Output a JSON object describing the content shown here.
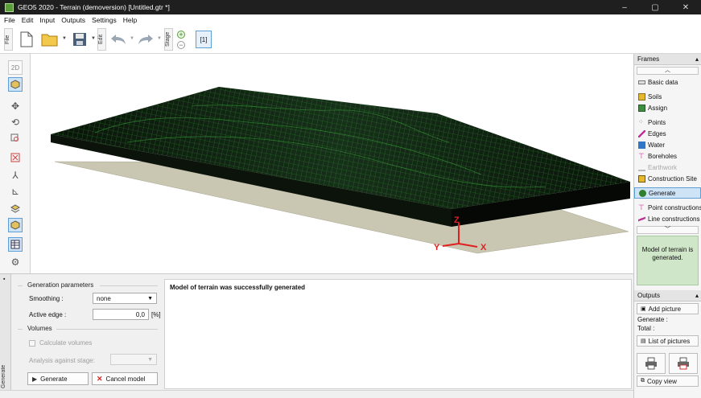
{
  "window": {
    "title": "GEO5 2020 - Terrain (demoversion) [Untitled.gtr *]",
    "minimize": "–",
    "maximize": "▢",
    "close": "✕"
  },
  "menu": [
    "File",
    "Edit",
    "Input",
    "Outputs",
    "Settings",
    "Help"
  ],
  "toolbar": {
    "file_label": "File",
    "edit_label": "Edit",
    "stage_label": "Stage",
    "stage_value": "[1]"
  },
  "left_tools": {
    "view_2d": "2D"
  },
  "viewport": {
    "axis_z": "Z",
    "axis_y": "Y",
    "axis_x": "X"
  },
  "right_panel": {
    "frames_label": "Frames",
    "items": [
      {
        "label": "Basic data",
        "state": "normal"
      },
      {
        "label": "Soils",
        "state": "normal"
      },
      {
        "label": "Assign",
        "state": "normal"
      },
      {
        "label": "Points",
        "state": "normal"
      },
      {
        "label": "Edges",
        "state": "normal"
      },
      {
        "label": "Water",
        "state": "normal"
      },
      {
        "label": "Boreholes",
        "state": "normal"
      },
      {
        "label": "Earthwork",
        "state": "disabled"
      },
      {
        "label": "Construction Site",
        "state": "normal"
      },
      {
        "label": "Generate",
        "state": "active"
      },
      {
        "label": "Point constructions",
        "state": "normal"
      },
      {
        "label": "Line constructions",
        "state": "normal"
      }
    ],
    "note": "Model of terrain is generated.",
    "outputs_label": "Outputs",
    "add_picture": "Add picture",
    "generate_label": "Generate :",
    "total_label": "Total :",
    "list_pictures": "List of pictures",
    "copy_view": "Copy view"
  },
  "bottom": {
    "tab_label": "Generate",
    "generation_params": "Generation parameters",
    "smoothing_label": "Smoothing :",
    "smoothing_value": "none",
    "active_edge_label": "Active edge :",
    "active_edge_value": "0,0",
    "active_edge_unit": "[%]",
    "volumes": "Volumes",
    "calc_volumes": "Calculate volumes",
    "analysis_stage": "Analysis against stage:",
    "generate_btn": "Generate",
    "cancel_btn": "Cancel model",
    "output_text": "Model of terrain was successfully generated"
  },
  "colors": {
    "accent": "#5ea0d6",
    "note_bg": "#cfe6c8",
    "terrain": "#0d1a0d",
    "mesh": "#2f8a2f"
  }
}
